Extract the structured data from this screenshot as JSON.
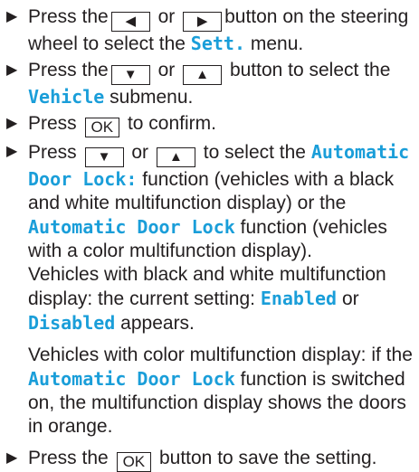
{
  "bullet": "▶",
  "keys": {
    "left": "◀",
    "right": "▶",
    "down": "▼",
    "up": "▲",
    "ok": "OK"
  },
  "steps": [
    {
      "a": "Press the",
      "or": "or",
      "b": "button on the steering wheel to select the",
      "menu": "Sett.",
      "c": "menu."
    },
    {
      "a": "Press the",
      "or": "or",
      "b": "button to select the",
      "submenu": "Vehicle",
      "c": "submenu."
    },
    {
      "a": "Press",
      "b": "to confirm."
    },
    {
      "a": "Press",
      "or": "or",
      "b": "to select the",
      "func1": "Automatic Door Lock:",
      "c": "function (vehicles with a black and white multifunction display) or the",
      "func2": "Automatic Door Lock",
      "d": "function (vehicles with a color multifunction display).",
      "p2a": "Vehicles with black and white multifunction display: the current setting:",
      "enabled": "Enabled",
      "or2": "or",
      "disabled": "Disabled",
      "p2b": "appears.",
      "p3a": "Vehicles with color multifunction display: if the",
      "func3": "Automatic Door Lock",
      "p3b": "function is switched on, the multifunction display shows the doors in orange."
    },
    {
      "a": "Press the",
      "b": "button to save the setting."
    }
  ]
}
